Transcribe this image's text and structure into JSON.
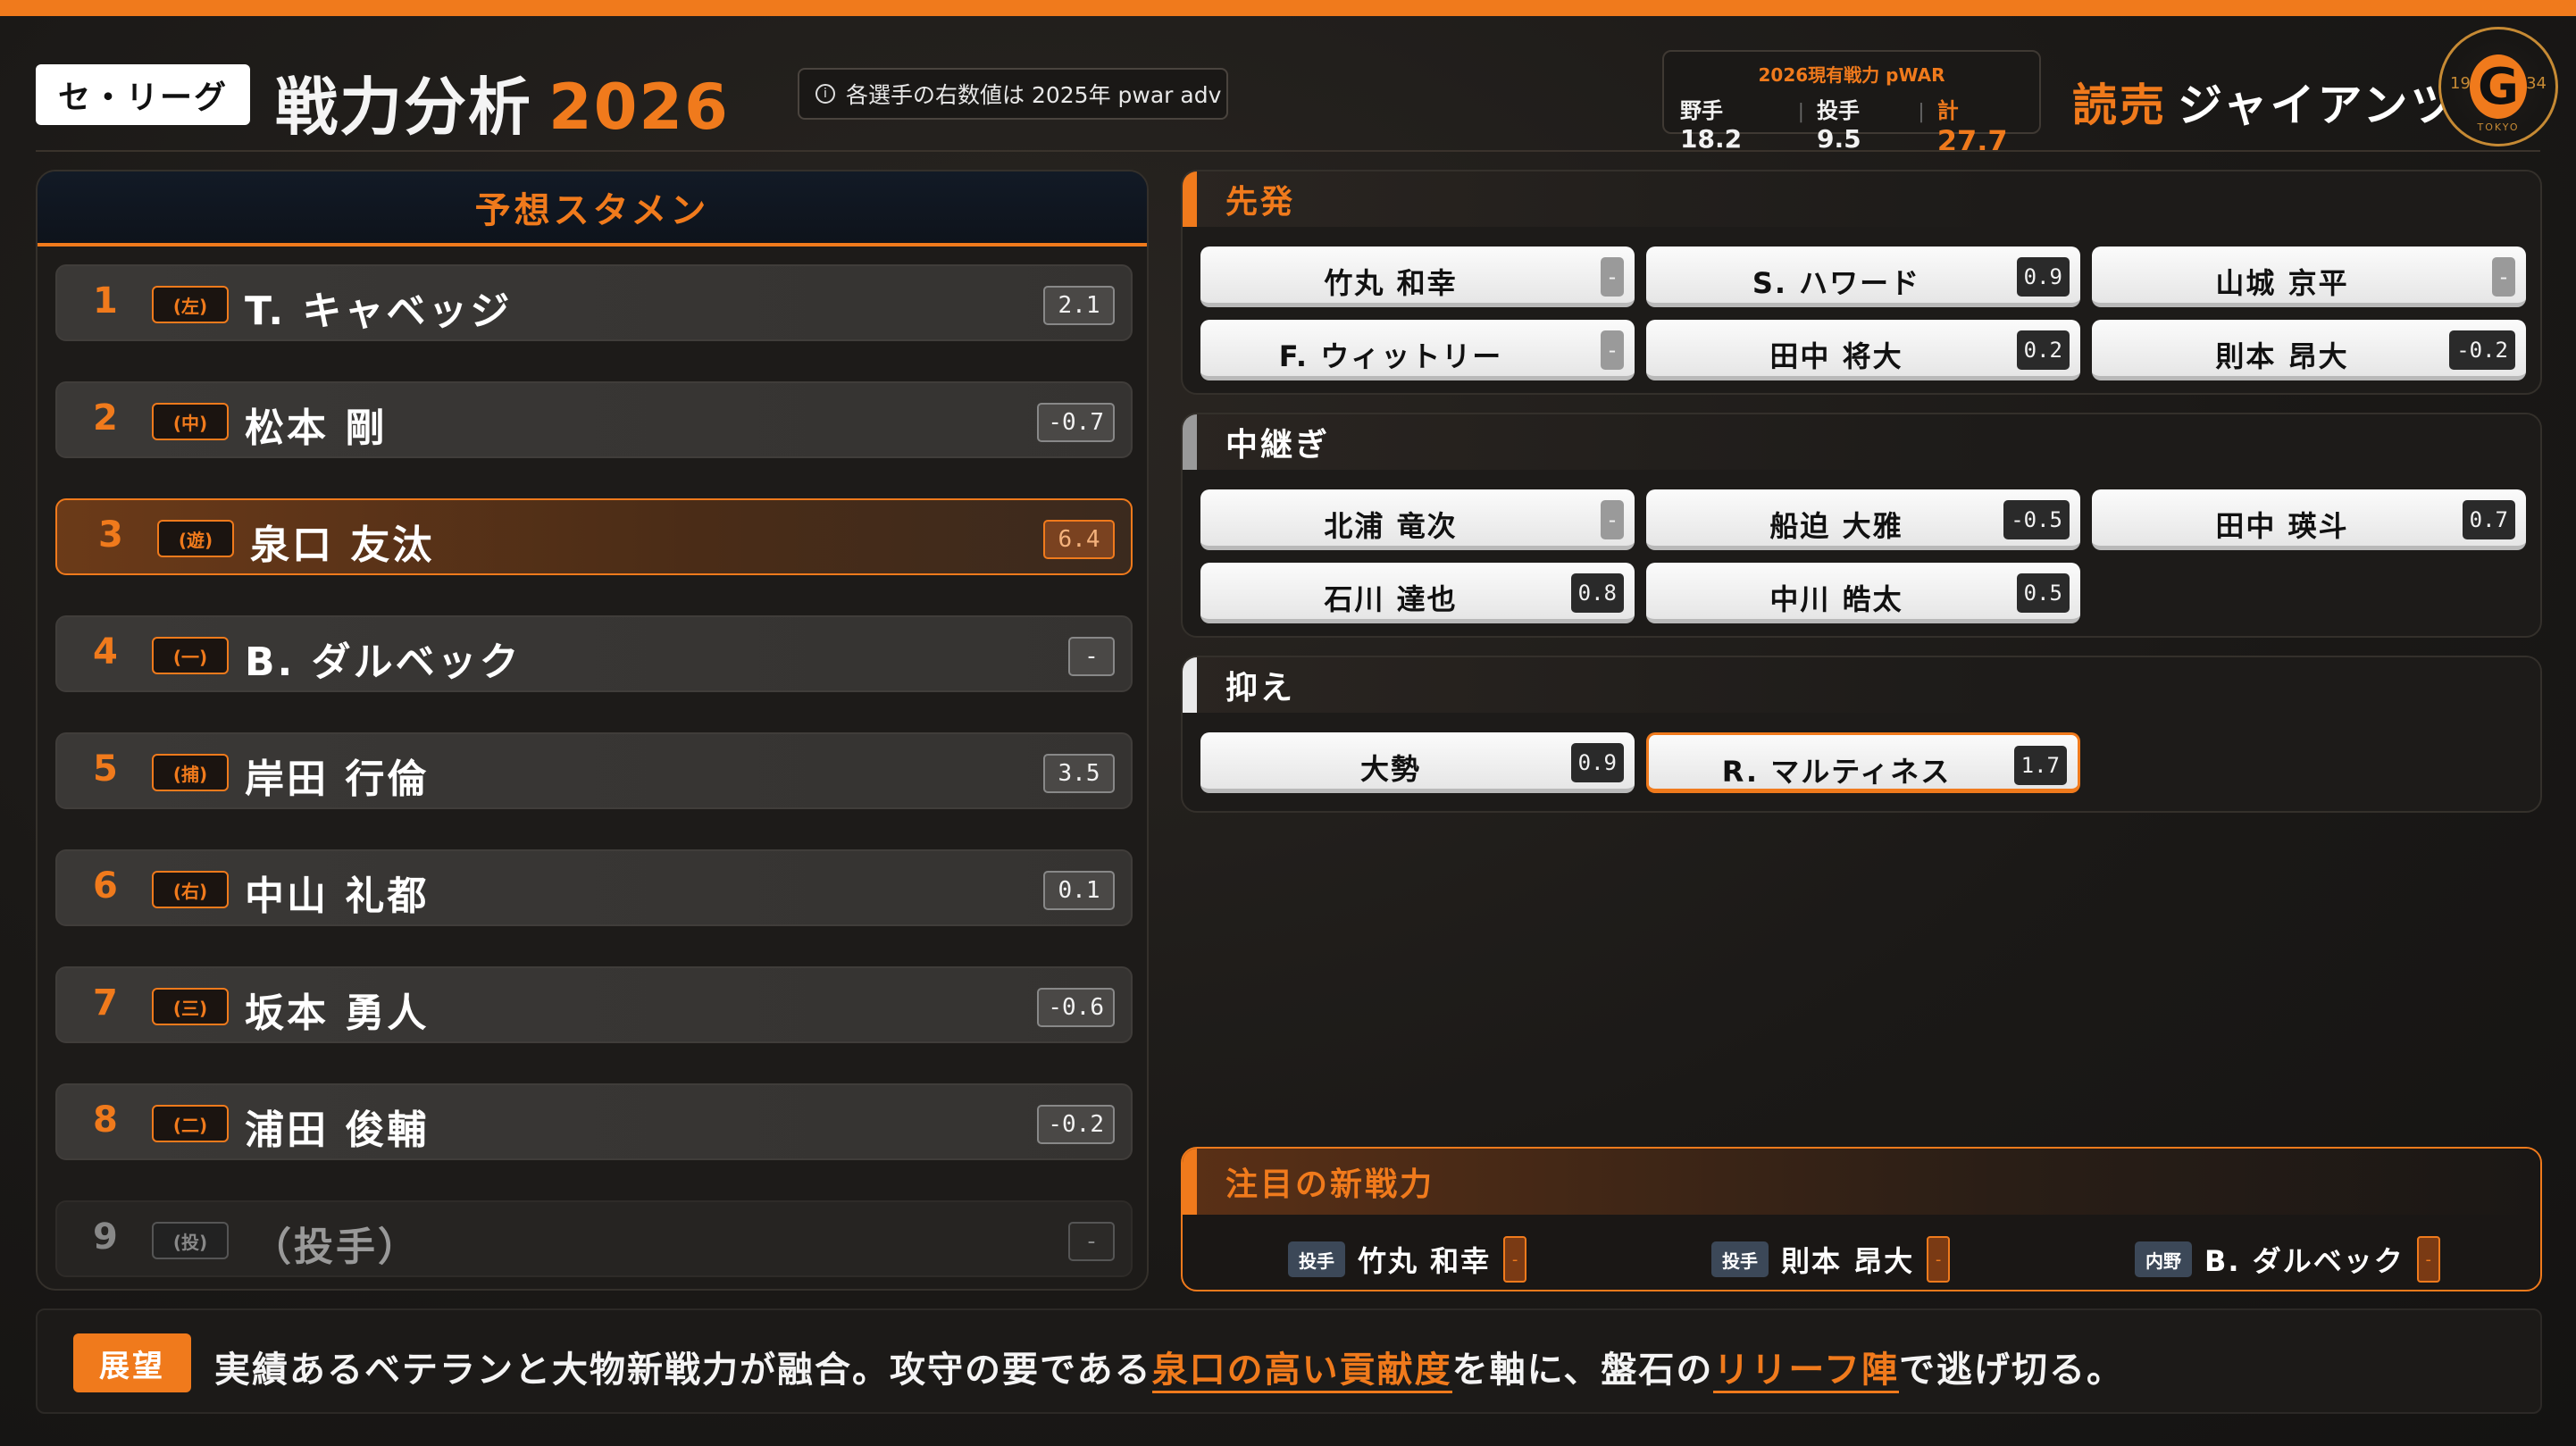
{
  "header": {
    "league": "セ・リーグ",
    "title": "戦力分析",
    "year": "2026",
    "note": "各選手の右数値は 2025年 pwar adv",
    "war_summary": {
      "title": "2026現有戦力 pWAR",
      "fielder_label": "野手",
      "fielder_value": "18.2",
      "pitcher_label": "投手",
      "pitcher_value": "9.5",
      "total_label": "計",
      "total_value": "27.7"
    },
    "team_prefix": "読売",
    "team_name": "ジャイアンツ",
    "logo": {
      "letter": "G",
      "year_left": "19",
      "year_right": "34",
      "city": "TOKYO"
    }
  },
  "lineup": {
    "title": "予想スタメン",
    "rows": [
      {
        "order": "1",
        "pos": "(左)",
        "name": "T. キャベッジ",
        "war": "2.1"
      },
      {
        "order": "2",
        "pos": "(中)",
        "name": "松本 剛",
        "war": "-0.7"
      },
      {
        "order": "3",
        "pos": "(遊)",
        "name": "泉口 友汰",
        "war": "6.4"
      },
      {
        "order": "4",
        "pos": "(一)",
        "name": "B. ダルベック",
        "war": "-"
      },
      {
        "order": "5",
        "pos": "(捕)",
        "name": "岸田 行倫",
        "war": "3.5"
      },
      {
        "order": "6",
        "pos": "(右)",
        "name": "中山 礼都",
        "war": "0.1"
      },
      {
        "order": "7",
        "pos": "(三)",
        "name": "坂本 勇人",
        "war": "-0.6"
      },
      {
        "order": "8",
        "pos": "(二)",
        "name": "浦田 俊輔",
        "war": "-0.2"
      },
      {
        "order": "9",
        "pos": "(投)",
        "name": "（投手）",
        "war": "-"
      }
    ]
  },
  "rotation": {
    "title": "先発",
    "players": [
      {
        "name": "竹丸 和幸",
        "war": "-"
      },
      {
        "name": "S. ハワード",
        "war": "0.9"
      },
      {
        "name": "山城 京平",
        "war": "-"
      },
      {
        "name": "F. ウィットリー",
        "war": "-"
      },
      {
        "name": "田中 将大",
        "war": "0.2"
      },
      {
        "name": "則本 昂大",
        "war": "-0.2"
      }
    ]
  },
  "middle": {
    "title": "中継ぎ",
    "players": [
      {
        "name": "北浦 竜次",
        "war": "-"
      },
      {
        "name": "船迫 大雅",
        "war": "-0.5"
      },
      {
        "name": "田中 瑛斗",
        "war": "0.7"
      },
      {
        "name": "石川 達也",
        "war": "0.8"
      },
      {
        "name": "中川 皓太",
        "war": "0.5"
      }
    ]
  },
  "closer": {
    "title": "抑え",
    "players": [
      {
        "name": "大勢",
        "war": "0.9"
      },
      {
        "name": "R. マルティネス",
        "war": "1.7"
      }
    ]
  },
  "new_players": {
    "title": "注目の新戦力",
    "items": [
      {
        "tag": "投手",
        "name": "竹丸 和幸",
        "war": "-"
      },
      {
        "tag": "投手",
        "name": "則本 昂大",
        "war": "-"
      },
      {
        "tag": "内野",
        "name": "B. ダルベック",
        "war": "-"
      }
    ]
  },
  "outlook": {
    "label": "展望",
    "text_1": "実績あるベテランと大物新戦力が融合。攻守の要である",
    "em_1": "泉口の高い貢献度",
    "text_2": "を軸に、盤石の",
    "em_2": "リリーフ陣",
    "text_3": "で逃げ切る。"
  },
  "colors": {
    "accent": "#f07a1c",
    "background": "#1b1917",
    "card": "#f2f2f2"
  }
}
